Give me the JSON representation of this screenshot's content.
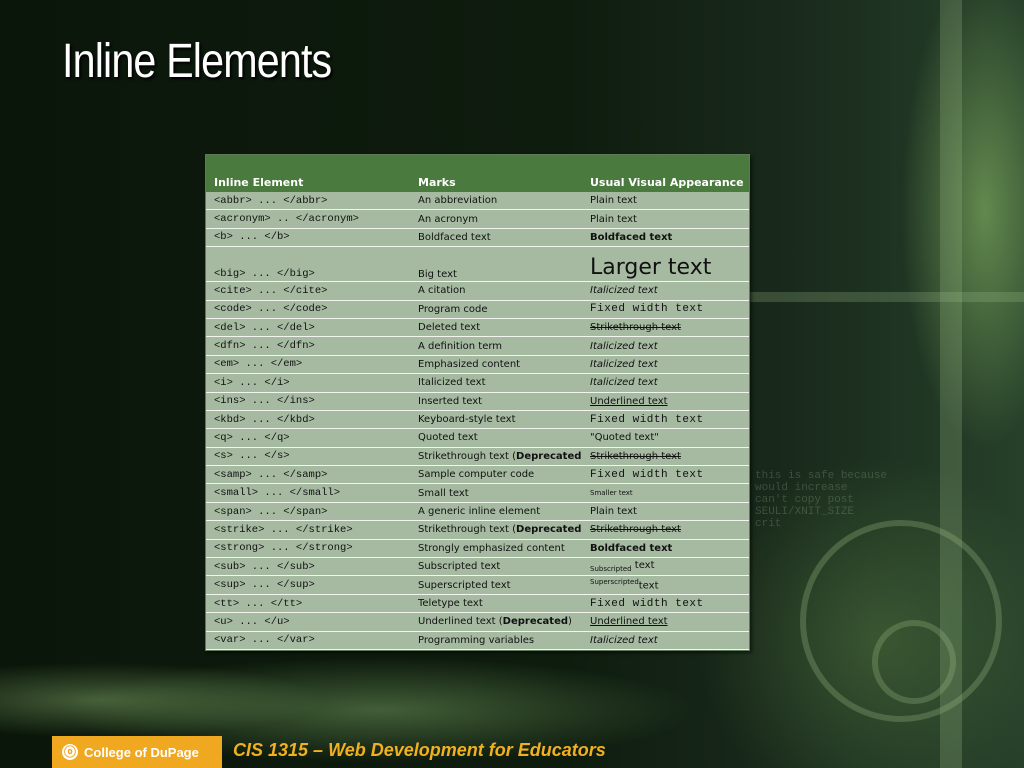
{
  "slide": {
    "title": "Inline Elements",
    "footer_logo_text": "College of DuPage",
    "footer_course": "CIS 1315 – Web Development for Educators"
  },
  "table": {
    "headers": [
      "Inline Element",
      "Marks",
      "Usual Visual Appearance"
    ],
    "rows": [
      {
        "el": "<abbr> ... </abbr>",
        "marks": "An abbreviation",
        "deprecated": false,
        "look": "Plain text",
        "style": "plain"
      },
      {
        "el": "<acronym> .. </acronym>",
        "marks": "An acronym",
        "deprecated": false,
        "look": "Plain text",
        "style": "plain"
      },
      {
        "el": "<b> ... </b>",
        "marks": "Boldfaced text",
        "deprecated": false,
        "look": "Boldfaced text",
        "style": "bold"
      },
      {
        "el": "<big> ... </big>",
        "marks": "Big text",
        "deprecated": false,
        "look": "Larger text",
        "style": "large"
      },
      {
        "el": "<cite> ... </cite>",
        "marks": "A citation",
        "deprecated": false,
        "look": "Italicized text",
        "style": "italic"
      },
      {
        "el": "<code> ... </code>",
        "marks": "Program code",
        "deprecated": false,
        "look": "Fixed width text",
        "style": "mono"
      },
      {
        "el": "<del> ... </del>",
        "marks": "Deleted text",
        "deprecated": false,
        "look": "Strikethrough text",
        "style": "strike"
      },
      {
        "el": "<dfn> ... </dfn>",
        "marks": "A definition term",
        "deprecated": false,
        "look": "Italicized text",
        "style": "italic"
      },
      {
        "el": "<em> ... </em>",
        "marks": "Emphasized content",
        "deprecated": false,
        "look": "Italicized text",
        "style": "italic"
      },
      {
        "el": "<i> ... </i>",
        "marks": "Italicized text",
        "deprecated": false,
        "look": "Italicized text",
        "style": "italic"
      },
      {
        "el": "<ins> ... </ins>",
        "marks": "Inserted text",
        "deprecated": false,
        "look": "Underlined text",
        "style": "under"
      },
      {
        "el": "<kbd> ... </kbd>",
        "marks": "Keyboard-style text",
        "deprecated": false,
        "look": "Fixed width text",
        "style": "mono"
      },
      {
        "el": "<q> ... </q>",
        "marks": "Quoted text",
        "deprecated": false,
        "look": "\"Quoted text\"",
        "style": "plain"
      },
      {
        "el": "<s> ... </s>",
        "marks": "Strikethrough text",
        "deprecated": true,
        "look": "Strikethrough text",
        "style": "strike"
      },
      {
        "el": "<samp> ... </samp>",
        "marks": "Sample computer code",
        "deprecated": false,
        "look": "Fixed width text",
        "style": "mono"
      },
      {
        "el": "<small> ... </small>",
        "marks": "Small text",
        "deprecated": false,
        "look": "Smaller text",
        "style": "small"
      },
      {
        "el": "<span> ... </span>",
        "marks": "A generic inline element",
        "deprecated": false,
        "look": "Plain text",
        "style": "plain"
      },
      {
        "el": "<strike> ... </strike>",
        "marks": "Strikethrough text",
        "deprecated": true,
        "look": "Strikethrough text",
        "style": "strike"
      },
      {
        "el": "<strong> ... </strong>",
        "marks": "Strongly emphasized content",
        "deprecated": false,
        "look": "Boldfaced text",
        "style": "bold"
      },
      {
        "el": "<sub> ... </sub>",
        "marks": "Subscripted text",
        "deprecated": false,
        "look": "Subscripted",
        "look_tail": " text",
        "style": "sub"
      },
      {
        "el": "<sup> ... </sup>",
        "marks": "Superscripted text",
        "deprecated": false,
        "look": "Superscripted",
        "look_tail": "text",
        "style": "sup"
      },
      {
        "el": "<tt> ... </tt>",
        "marks": "Teletype text",
        "deprecated": false,
        "look": "Fixed width text",
        "style": "mono"
      },
      {
        "el": "<u> ... </u>",
        "marks": "Underlined text",
        "deprecated": true,
        "look": "Underlined text",
        "style": "under"
      },
      {
        "el": "<var> ... </var>",
        "marks": "Programming variables",
        "deprecated": false,
        "look": "Italicized text",
        "style": "italic"
      }
    ],
    "deprecated_label": "Deprecated"
  },
  "colors": {
    "header_bg": "#4a7a3e",
    "row_bg": "#a6baa2",
    "title_text": "#ffffff",
    "footer_accent": "#f0b020",
    "logo_bg": "#f0a820"
  },
  "icons": {
    "logo": "college-of-dupage-logo-icon"
  }
}
